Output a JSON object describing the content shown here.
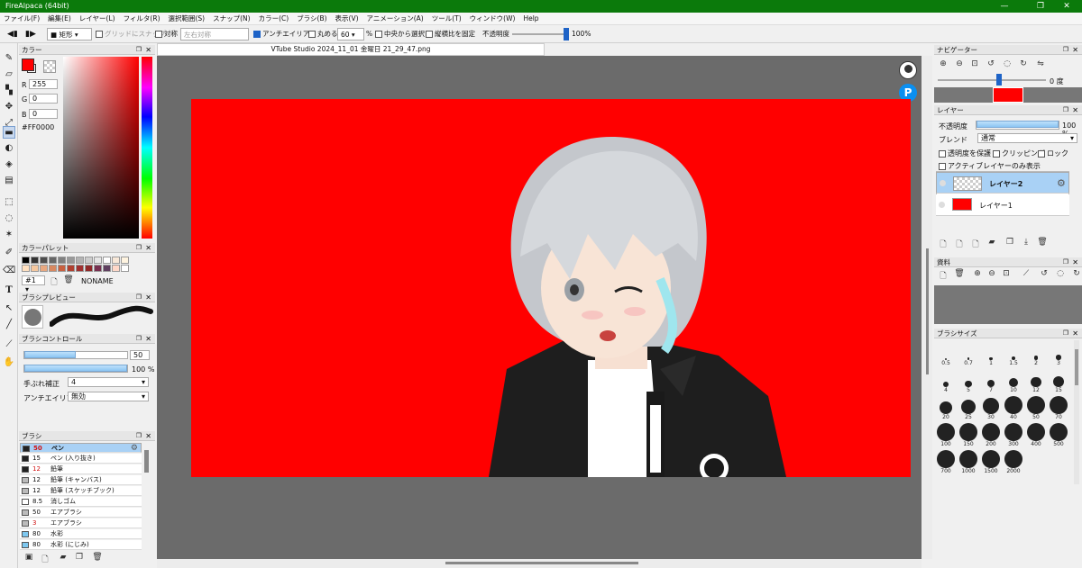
{
  "window": {
    "title": "FireAlpaca (64bit)",
    "minimize": "—",
    "maximize": "❐",
    "close": "✕"
  },
  "menu": [
    "ファイル(F)",
    "編集(E)",
    "レイヤー(L)",
    "フィルタ(R)",
    "選択範囲(S)",
    "スナップ(N)",
    "カラー(C)",
    "ブラシ(B)",
    "表示(V)",
    "アニメーション(A)",
    "ツール(T)",
    "ウィンドウ(W)",
    "Help"
  ],
  "toolbar": {
    "shape_select": "矩形",
    "grid_snap": "グリッドにスナップ",
    "symmetry": "対称",
    "symmetry_select": "左右対称",
    "antialias": "アンチエイリアス",
    "round": "丸める",
    "round_value": "60",
    "percent": "%",
    "from_center": "中央から選択",
    "fix_ratio": "縦横比を固定",
    "opacity_label": "不透明度",
    "opacity_value": "100%",
    "opacity_level": 1.0
  },
  "document": {
    "tab_title": "VTube Studio 2024_11_01 金曜日 21_29_47.png"
  },
  "color_panel": {
    "title": "カラー",
    "r_label": "R",
    "r": "255",
    "g_label": "G",
    "g": "0",
    "b_label": "B",
    "b": "0",
    "hex": "#FF0000",
    "primary": "#ff0000"
  },
  "palette_panel": {
    "title": "カラーパレット",
    "index": "#1",
    "name": "NONAME",
    "swatches": [
      "#000000",
      "#333333",
      "#4d4d4d",
      "#666666",
      "#808080",
      "#999999",
      "#b3b3b3",
      "#cccccc",
      "#e6e6e6",
      "#ffffff",
      "#f8e8d8",
      "#fff4e0",
      "#ffe0c0",
      "#f5c8a0",
      "#e8a880",
      "#d88860",
      "#c86040",
      "#b04030",
      "#a03030",
      "#902828",
      "#783050",
      "#604060",
      "#ffd8c8",
      "#ffffff"
    ]
  },
  "brush_preview": {
    "title": "ブラシプレビュー"
  },
  "brush_control": {
    "title": "ブラシコントロール",
    "size": "50",
    "opacity": "100 %",
    "size_level": 0.5,
    "opacity_level": 1.0,
    "stabilizer_label": "手ぶれ補正",
    "stabilizer": "4",
    "aa_label": "アンチエイリアス",
    "aa": "無効"
  },
  "brush_panel": {
    "title": "ブラシ",
    "items": [
      {
        "size": "50",
        "name": "ペン",
        "color": "#222222",
        "red": true,
        "selected": true
      },
      {
        "size": "15",
        "name": "ペン (入り抜き)",
        "color": "#222222",
        "red": false,
        "selected": false
      },
      {
        "size": "12",
        "name": "鉛筆",
        "color": "#222222",
        "red": true,
        "selected": false
      },
      {
        "size": "12",
        "name": "鉛筆 (キャンバス)",
        "color": "#bbbbbb",
        "red": false,
        "selected": false
      },
      {
        "size": "12",
        "name": "鉛筆 (スケッチブック)",
        "color": "#bbbbbb",
        "red": false,
        "selected": false
      },
      {
        "size": "8.5",
        "name": "消しゴム",
        "color": "#ffffff",
        "red": false,
        "selected": false
      },
      {
        "size": "50",
        "name": "エアブラシ",
        "color": "#bbbbbb",
        "red": false,
        "selected": false
      },
      {
        "size": "3",
        "name": "エアブラシ",
        "color": "#bbbbbb",
        "red": true,
        "selected": false
      },
      {
        "size": "80",
        "name": "水彩",
        "color": "#7ec8f0",
        "red": false,
        "selected": false
      },
      {
        "size": "80",
        "name": "水彩 (にじみ)",
        "color": "#7ec8f0",
        "red": false,
        "selected": false
      }
    ]
  },
  "navigator": {
    "title": "ナビゲーター",
    "angle": "0 度"
  },
  "layer_panel": {
    "title": "レイヤー",
    "opacity_label": "不透明度",
    "opacity": "100 %",
    "opacity_level": 1.0,
    "blend_label": "ブレンド",
    "blend": "通常",
    "protect_alpha": "透明度を保護",
    "clipping": "クリッピング",
    "lock": "ロック",
    "active_only": "アクティブレイヤーのみ表示",
    "layers": [
      {
        "name": "レイヤー2",
        "selected": true
      },
      {
        "name": "レイヤー1",
        "selected": false
      }
    ]
  },
  "material_panel": {
    "title": "資料"
  },
  "brush_size_panel": {
    "title": "ブラシサイズ",
    "sizes": [
      "0.5",
      "0.7",
      "1",
      "1.5",
      "2",
      "3",
      "4",
      "5",
      "7",
      "10",
      "12",
      "15",
      "20",
      "25",
      "30",
      "40",
      "50",
      "70",
      "100",
      "150",
      "200",
      "300",
      "400",
      "500",
      "700",
      "1000",
      "1500",
      "2000"
    ]
  }
}
